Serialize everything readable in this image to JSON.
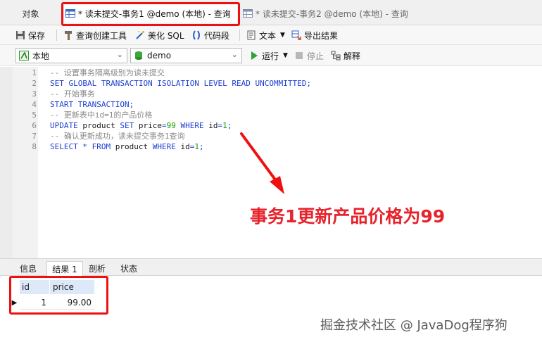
{
  "tabs": {
    "objects": "对象",
    "query1": "* 读未提交-事务1 @demo (本地) - 查询",
    "query2": "* 读未提交-事务2 @demo (本地) - 查询"
  },
  "toolbar1": {
    "save": "保存",
    "query_builder": "查询创建工具",
    "beautify": "美化 SQL",
    "snippet": "代码段",
    "text": "文本",
    "export": "导出结果"
  },
  "toolbar2": {
    "connection": "本地",
    "database": "demo",
    "run": "运行",
    "stop": "停止",
    "explain": "解释"
  },
  "editor": {
    "lines": [
      {
        "n": "1",
        "text": "-- 设置事务隔离级别为读未提交"
      },
      {
        "n": "2",
        "text": "SET GLOBAL TRANSACTION ISOLATION LEVEL READ UNCOMMITTED;"
      },
      {
        "n": "3",
        "text": "-- 开始事务"
      },
      {
        "n": "4",
        "text": "START TRANSACTION;"
      },
      {
        "n": "5",
        "text": "-- 更新表中id=1的产品价格"
      },
      {
        "n": "6",
        "text": "UPDATE product SET price=99 WHERE id=1;"
      },
      {
        "n": "7",
        "text": "-- 确认更新成功，读未提交事务1查询"
      },
      {
        "n": "8",
        "text": "SELECT * FROM product WHERE id=1;"
      }
    ]
  },
  "annotation": "事务1更新产品价格为99",
  "result_tabs": {
    "info": "信息",
    "result1": "结果 1",
    "profile": "剖析",
    "status": "状态"
  },
  "result_grid": {
    "columns": [
      "id",
      "price"
    ],
    "rows": [
      [
        "1",
        "99.00"
      ]
    ]
  },
  "colors": {
    "highlight": "#ee1111",
    "keyword": "#1e3fd0",
    "number": "#11a000",
    "comment": "#8a8a8a"
  },
  "watermark": "掘金技术社区 @ JavaDog程序狗"
}
